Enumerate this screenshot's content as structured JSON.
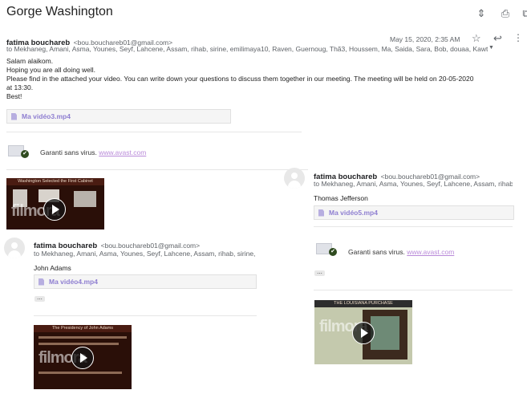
{
  "subject": "Gorge Washington",
  "toolbar_icons": [
    "expand-icon",
    "print-icon",
    "open-in-new-window-icon"
  ],
  "message_main": {
    "sender_name": "fatima bouchareb",
    "sender_email": "<bou.bouchareb01@gmail.com>",
    "to": "to Mekhaneg, Amani, Asma, Younes, Seyf, Lahcene, Assam, rihab, sirine, emilimaya10, Raven, Guernoug, Thã3, Houssem, Ma, Saida, Sara, Bob, douaa, Kawth",
    "date": "May 15, 2020, 2:35 AM",
    "body": [
      "Salam alaikom.",
      "Hoping you are all  doing well.",
      "Please find in the attached your video. You can write down your questions to discuss them together in our meeting. The meeting will be held on 20-05-2020",
      "at 13:30.",
      "Best!"
    ],
    "attachment": "Ma vidéo3.mp4"
  },
  "virus": {
    "text": "Garanti sans virus.",
    "link": "www.avast.com"
  },
  "video1": {
    "slide_title": "Washington Selected the First Cabinet",
    "watermark": "filmora"
  },
  "message_right": {
    "sender_name": "fatima bouchareb",
    "sender_email": "<bou.bouchareb01@gmail.com>",
    "to": "to Mekhaneg, Amani, Asma, Younes, Seyf, Lahcene, Assam, rihab, sirine, -",
    "body": "Thomas Jefferson",
    "attachment": "Ma vidéo5.mp4"
  },
  "message_left": {
    "sender_name": "fatima bouchareb",
    "sender_email": "<bou.bouchareb01@gmail.com>",
    "to": "to Mekhaneg, Amani, Asma, Younes, Seyf, Lahcene, Assam, rihab, sirine, -",
    "body": "John Adams",
    "attachment": "Ma vidéo4.mp4"
  },
  "video2": {
    "slide_title": "The Presidency of John Adams",
    "watermark": "filmora"
  },
  "video3": {
    "slide_title": "THE LOUISIANA PURCHASE",
    "watermark": "filmora"
  },
  "colors": {
    "attachment_text": "#8f7fd1",
    "link": "#b98ad9",
    "virus_check": "#2f4b1f"
  }
}
